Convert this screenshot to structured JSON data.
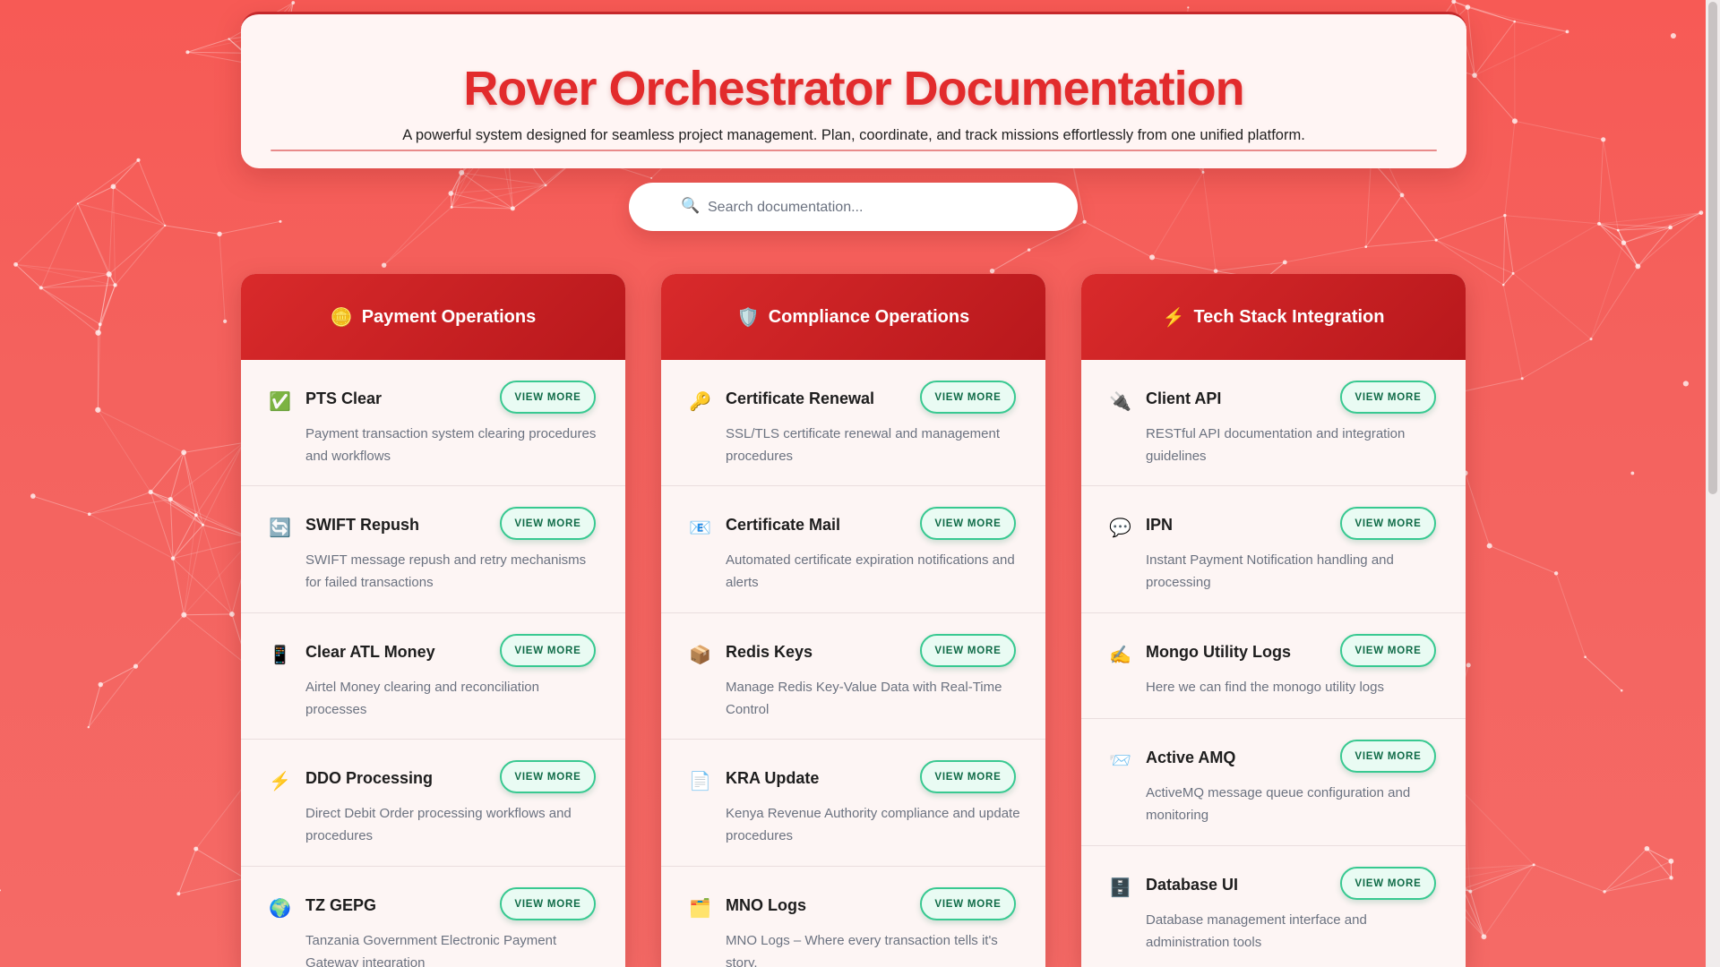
{
  "header": {
    "title": "Rover Orchestrator Documentation",
    "subtitle": "A powerful system designed for seamless project management. Plan, coordinate, and track missions effortlessly from one unified platform."
  },
  "search": {
    "icon": "🔍",
    "placeholder": "Search documentation..."
  },
  "button_label": "VIEW MORE",
  "colors": {
    "background": "#f75a55",
    "accent": "#e22b2c",
    "column_header": "#c5282b",
    "button_border": "#38c991"
  },
  "columns": [
    {
      "icon": "🪙",
      "title": "Payment Operations",
      "items": [
        {
          "icon": "✅",
          "title": "PTS Clear",
          "description": "Payment transaction system clearing procedures and workflows"
        },
        {
          "icon": "🔄",
          "title": "SWIFT Repush",
          "description": "SWIFT message repush and retry mechanisms for failed transactions"
        },
        {
          "icon": "📱",
          "title": "Clear ATL Money",
          "description": "Airtel Money clearing and reconciliation processes"
        },
        {
          "icon": "⚡",
          "title": "DDO Processing",
          "description": "Direct Debit Order processing workflows and procedures"
        },
        {
          "icon": "🌍",
          "title": "TZ GEPG",
          "description": "Tanzania Government Electronic Payment Gateway integration"
        }
      ]
    },
    {
      "icon": "🛡️",
      "title": "Compliance Operations",
      "items": [
        {
          "icon": "🔑",
          "title": "Certificate Renewal",
          "description": "SSL/TLS certificate renewal and management procedures"
        },
        {
          "icon": "📧",
          "title": "Certificate Mail",
          "description": "Automated certificate expiration notifications and alerts"
        },
        {
          "icon": "📦",
          "title": "Redis Keys",
          "description": "Manage Redis Key-Value Data with Real-Time Control"
        },
        {
          "icon": "📄",
          "title": "KRA Update",
          "description": "Kenya Revenue Authority compliance and update procedures"
        },
        {
          "icon": "🗂️",
          "title": "MNO Logs",
          "description": "MNO Logs – Where every transaction tells it's story."
        }
      ]
    },
    {
      "icon": "⚡",
      "title": "Tech Stack Integration",
      "items": [
        {
          "icon": "🔌",
          "title": "Client API",
          "description": "RESTful API documentation and integration guidelines"
        },
        {
          "icon": "💬",
          "title": "IPN",
          "description": "Instant Payment Notification handling and processing"
        },
        {
          "icon": "✍️",
          "title": "Mongo Utility Logs",
          "description": "Here we can find the monogo utility logs"
        },
        {
          "icon": "📨",
          "title": "Active AMQ",
          "description": "ActiveMQ message queue configuration and monitoring"
        },
        {
          "icon": "🗄️",
          "title": "Database UI",
          "description": "Database management interface and administration tools"
        }
      ]
    }
  ]
}
